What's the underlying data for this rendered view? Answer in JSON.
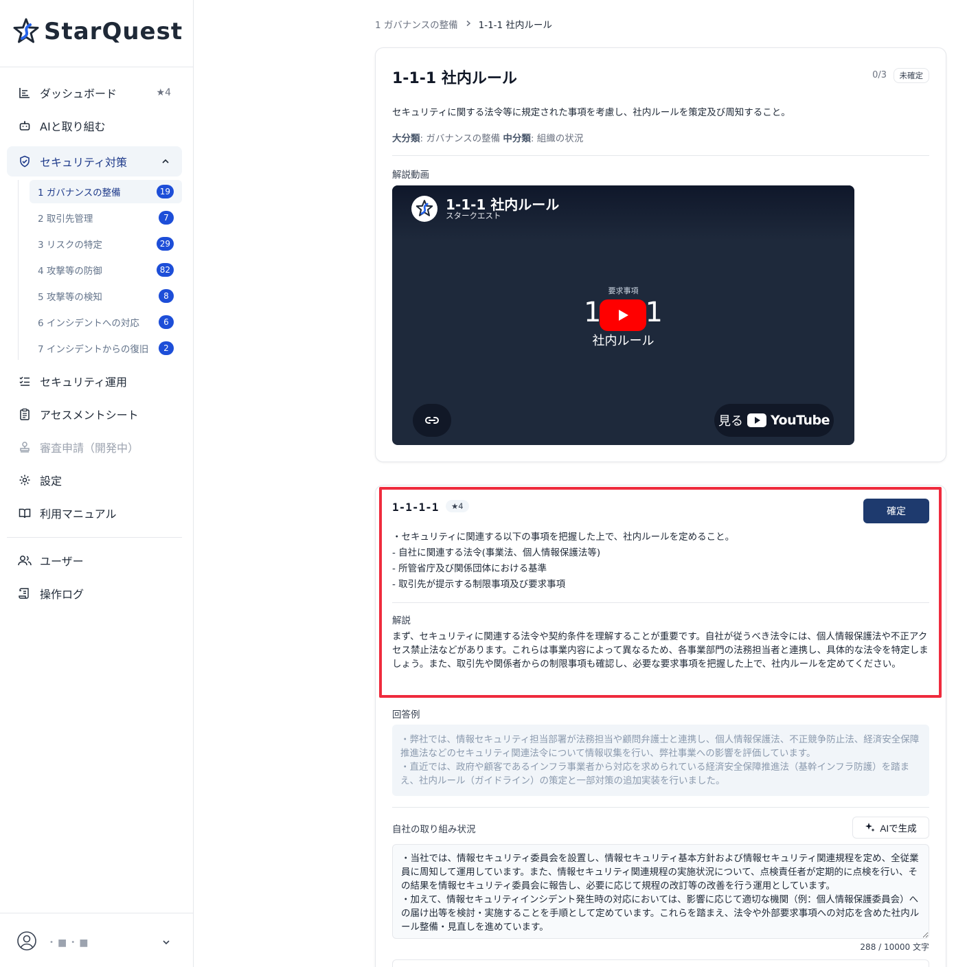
{
  "app": {
    "name": "StarQuest"
  },
  "sidebar": {
    "items": [
      {
        "label": "ダッシュボード",
        "badge": "★4"
      },
      {
        "label": "AIと取り組む"
      },
      {
        "label": "セキュリティ対策"
      },
      {
        "label": "セキュリティ運用"
      },
      {
        "label": "アセスメントシート"
      },
      {
        "label": "審査申請（開発中）"
      },
      {
        "label": "設定"
      },
      {
        "label": "利用マニュアル"
      },
      {
        "label": "ユーザー"
      },
      {
        "label": "操作ログ"
      }
    ],
    "sub_items": [
      {
        "label": "1 ガバナンスの整備",
        "count": "19"
      },
      {
        "label": "2 取引先管理",
        "count": "7"
      },
      {
        "label": "3 リスクの特定",
        "count": "29"
      },
      {
        "label": "4 攻撃等の防御",
        "count": "82"
      },
      {
        "label": "5 攻撃等の検知",
        "count": "8"
      },
      {
        "label": "6 インシデントへの対応",
        "count": "6"
      },
      {
        "label": "7 インシデントからの復旧",
        "count": "2"
      }
    ],
    "user": {
      "name": "・■・■"
    }
  },
  "breadcrumb": {
    "parent": "1 ガバナンスの整備",
    "current": "1-1-1 社内ルール"
  },
  "card": {
    "title": "1-1-1 社内ルール",
    "progress": "0/3",
    "status": "未確定",
    "description": "セキュリティに関する法令等に規定された事項を考慮し、社内ルールを策定及び周知すること。",
    "major_label": "大分類",
    "major_value": ": ガバナンスの整備",
    "minor_label": "中分類",
    "minor_value": ": 組織の状況",
    "video_label": "解説動画"
  },
  "video": {
    "title": "1-1-1 社内ルール",
    "channel": "スタークエスト",
    "small_text": "要求事項",
    "big_left": "1",
    "big_right": "1",
    "sub_text": "社内ルール",
    "watch_label": "見る",
    "youtube": "YouTube"
  },
  "requirement": {
    "id": "1-1-1-1",
    "star": "★4",
    "confirm_label": "確定",
    "lines": [
      "・セキュリティに関連する以下の事項を把握した上で、社内ルールを定めること。",
      "- 自社に関連する法令(事業法、個人情報保護法等)",
      "- 所管省庁及び関係団体における基準",
      "- 取引先が提示する制限事項及び要求事項"
    ],
    "explanation_label": "解説",
    "explanation": "まず、セキュリティに関連する法令や契約条件を理解することが重要です。自社が従うべき法令には、個人情報保護法や不正アクセス禁止法などがあります。これらは事業内容によって異なるため、各事業部門の法務担当者と連携し、具体的な法令を特定しましょう。また、取引先や関係者からの制限事項も確認し、必要な要求事項を把握した上で、社内ルールを定めてください。",
    "example_label": "回答例",
    "example": "・弊社では、情報セキュリティ担当部署が法務担当や顧問弁護士と連携し、個人情報保護法、不正競争防止法、経済安全保障推進法などのセキュリティ関連法令について情報収集を行い、弊社事業への影響を評価しています。\n・直近では、政府や顧客であるインフラ事業者から対応を求められている経済安全保障推進法（基幹インフラ防護）を踏まえ、社内ルール（ガイドライン）の策定と一部対策の追加実装を行いました。",
    "status_label": "自社の取り組み状況",
    "ai_button": "AIで生成",
    "answer": "・当社では、情報セキュリティ委員会を設置し、情報セキュリティ基本方針および情報セキュリティ関連規程を定め、全従業員に周知して運用しています。また、情報セキュリティ関連規程の実施状況について、点検責任者が定期的に点検を行い、その結果を情報セキュリティ委員会に報告し、必要に応じて規程の改訂等の改善を行う運用としています。\n・加えて、情報セキュリティインシデント発生時の対応においては、影響に応じて適切な機関（例：個人情報保護委員会）への届け出等を検討・実施することを手順として定めています。これらを踏まえ、法令や外部要求事項への対応を含めた社内ルール整備・見直しを進めています。",
    "char_count": "288 / 10000 文字"
  }
}
